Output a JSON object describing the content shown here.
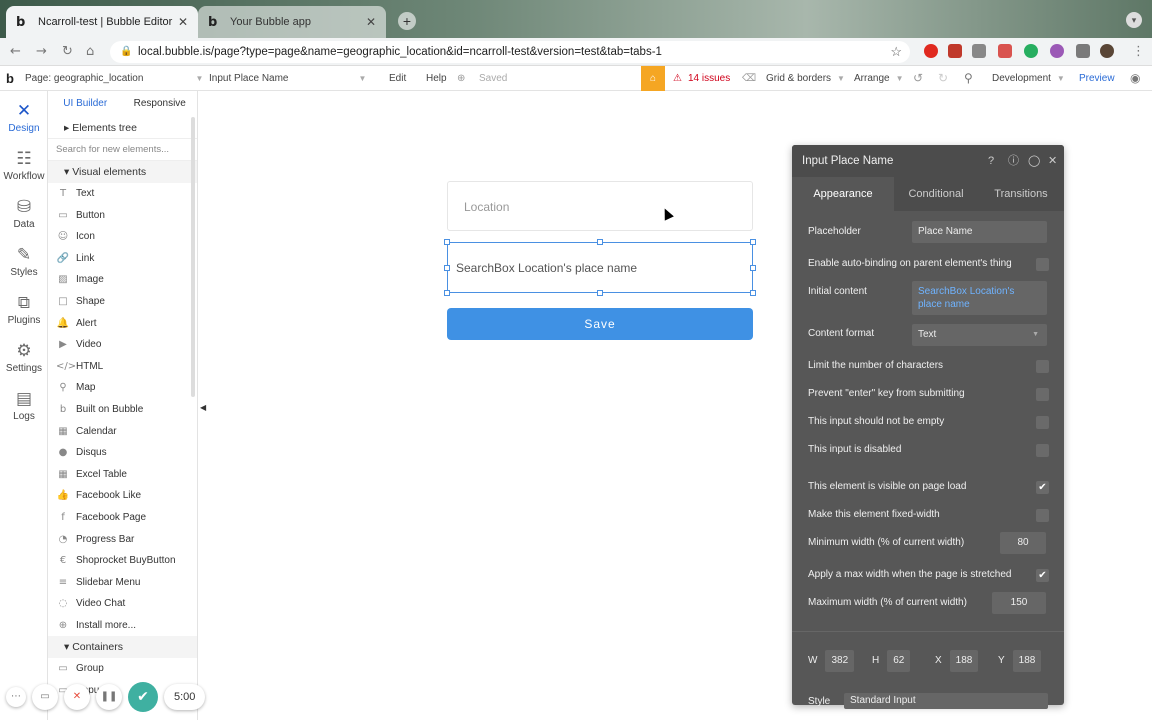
{
  "browser": {
    "tabs": [
      {
        "title": "Ncarroll-test | Bubble Editor",
        "active": true
      },
      {
        "title": "Your Bubble app",
        "active": false
      }
    ],
    "url": "local.bubble.is/page?type=page&name=geographic_location&id=ncarroll-test&version=test&tab=tabs-1"
  },
  "editor_bar": {
    "page": "Page: geographic_location",
    "element": "Input Place Name",
    "edit": "Edit",
    "help": "Help",
    "saved": "Saved",
    "issues": "14 issues",
    "grid": "Grid & borders",
    "arrange": "Arrange",
    "development": "Development",
    "preview": "Preview",
    "accent": "#f5a623"
  },
  "left_nav": [
    {
      "label": "Design",
      "icon": "design-icon",
      "glyph": "✕"
    },
    {
      "label": "Workflow",
      "icon": "workflow-icon",
      "glyph": "☷"
    },
    {
      "label": "Data",
      "icon": "database-icon",
      "glyph": "⛁"
    },
    {
      "label": "Styles",
      "icon": "brush-icon",
      "glyph": "✎"
    },
    {
      "label": "Plugins",
      "icon": "plugin-icon",
      "glyph": "⧉"
    },
    {
      "label": "Settings",
      "icon": "gear-icon",
      "glyph": "⚙"
    },
    {
      "label": "Logs",
      "icon": "logs-icon",
      "glyph": "▤"
    }
  ],
  "palette": {
    "tab_ui": "UI Builder",
    "tab_responsive": "Responsive",
    "elements_tree": "Elements tree",
    "search_placeholder": "Search for new elements...",
    "visual_section": "Visual elements",
    "containers_section": "Containers",
    "items": [
      {
        "label": "Text",
        "glyph": "T"
      },
      {
        "label": "Button",
        "glyph": "▭"
      },
      {
        "label": "Icon",
        "glyph": "☺"
      },
      {
        "label": "Link",
        "glyph": "🔗"
      },
      {
        "label": "Image",
        "glyph": "▨"
      },
      {
        "label": "Shape",
        "glyph": "□"
      },
      {
        "label": "Alert",
        "glyph": "🔔"
      },
      {
        "label": "Video",
        "glyph": "▶"
      },
      {
        "label": "HTML",
        "glyph": "</>"
      },
      {
        "label": "Map",
        "glyph": "⚲"
      },
      {
        "label": "Built on Bubble",
        "glyph": "b"
      },
      {
        "label": "Calendar",
        "glyph": "▦"
      },
      {
        "label": "Disqus",
        "glyph": "●"
      },
      {
        "label": "Excel Table",
        "glyph": "▦"
      },
      {
        "label": "Facebook Like",
        "glyph": "👍"
      },
      {
        "label": "Facebook Page",
        "glyph": "f"
      },
      {
        "label": "Progress Bar",
        "glyph": "◔"
      },
      {
        "label": "Shoprocket BuyButton",
        "glyph": "€"
      },
      {
        "label": "Slidebar Menu",
        "glyph": "≡"
      },
      {
        "label": "Video Chat",
        "glyph": "◌"
      },
      {
        "label": "Install more...",
        "glyph": "⊕"
      }
    ],
    "container_items": [
      {
        "label": "Group",
        "glyph": "▭"
      },
      {
        "label": "Popup",
        "glyph": "▭"
      }
    ]
  },
  "canvas": {
    "location_placeholder": "Location",
    "selected_input_text": "SearchBox Location's place name",
    "save_label": "Save"
  },
  "property_panel": {
    "title": "Input Place Name",
    "tabs": [
      "Appearance",
      "Conditional",
      "Transitions"
    ],
    "placeholder_label": "Placeholder",
    "placeholder_value": "Place Name",
    "autobinding": "Enable auto-binding on parent element's thing",
    "initial_content_label": "Initial content",
    "initial_content_value": "SearchBox Location's place name",
    "content_format_label": "Content format",
    "content_format_value": "Text",
    "limit_chars": "Limit the number of characters",
    "prevent_enter": "Prevent \"enter\" key from submitting",
    "not_empty": "This input should not be empty",
    "disabled": "This input is disabled",
    "visible_on_load": "This element is visible on page load",
    "fixed_width": "Make this element fixed-width",
    "min_width_label": "Minimum width (% of current width)",
    "min_width_value": "80",
    "max_width_stretch": "Apply a max width when the page is stretched",
    "max_width_label": "Maximum width (% of current width)",
    "max_width_value": "150",
    "w": "382",
    "h": "62",
    "x": "188",
    "y": "188",
    "w_label": "W",
    "h_label": "H",
    "x_label": "X",
    "y_label": "Y",
    "style_label": "Style",
    "style_value": "Standard Input"
  },
  "recorder": {
    "time": "5:00"
  }
}
